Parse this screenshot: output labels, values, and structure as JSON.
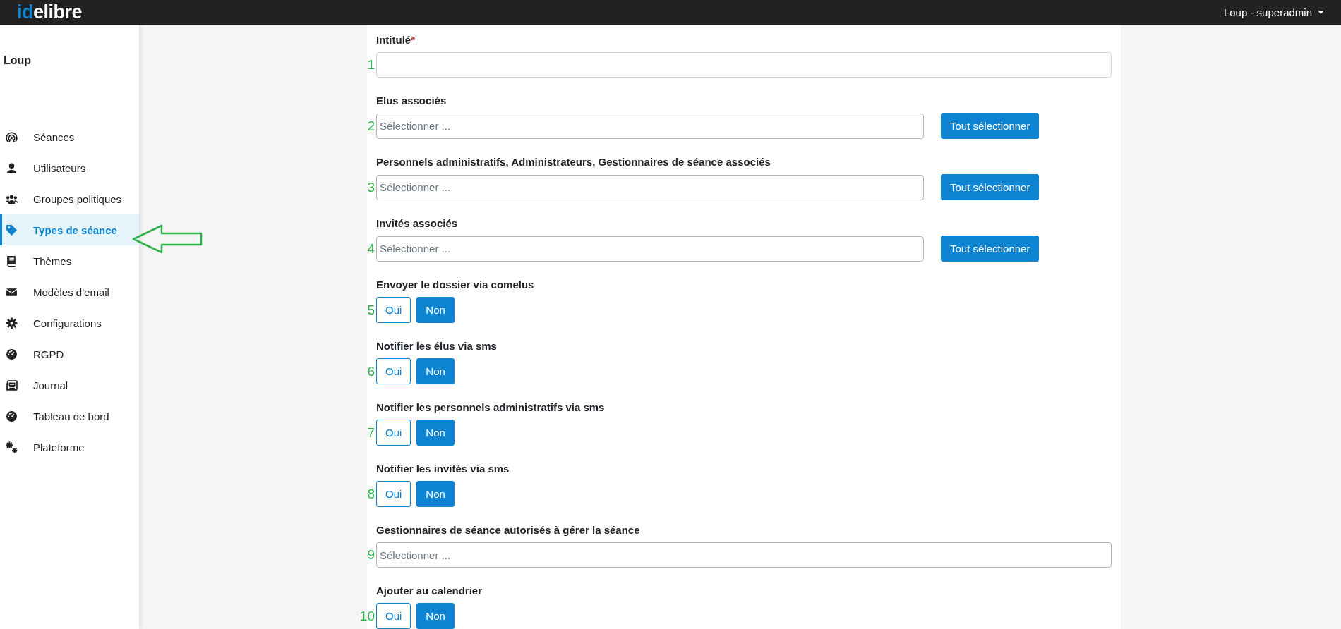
{
  "topbar": {
    "logo_accent": "id",
    "logo_rest": "elibre",
    "user_menu": "Loup - superadmin"
  },
  "sidebar": {
    "title": "Loup",
    "items": [
      {
        "label": "Séances",
        "selected": false
      },
      {
        "label": "Utilisateurs",
        "selected": false
      },
      {
        "label": "Groupes politiques",
        "selected": false
      },
      {
        "label": "Types de séance",
        "selected": true
      },
      {
        "label": "Thèmes",
        "selected": false
      },
      {
        "label": "Modèles d'email",
        "selected": false
      },
      {
        "label": "Configurations",
        "selected": false
      },
      {
        "label": "RGPD",
        "selected": false
      },
      {
        "label": "Journal",
        "selected": false
      },
      {
        "label": "Tableau de bord",
        "selected": false
      },
      {
        "label": "Plateforme",
        "selected": false
      }
    ]
  },
  "form": {
    "fields": [
      {
        "kind": "text",
        "marker": "1",
        "label": "Intitulé",
        "required_mark": "*"
      },
      {
        "kind": "select",
        "marker": "2",
        "label": "Elus associés",
        "placeholder": "Sélectionner ...",
        "button": "Tout sélectionner"
      },
      {
        "kind": "select",
        "marker": "3",
        "label": "Personnels administratifs, Administrateurs, Gestionnaires de séance associés",
        "placeholder": "Sélectionner ...",
        "button": "Tout sélectionner"
      },
      {
        "kind": "select",
        "marker": "4",
        "label": "Invités associés",
        "placeholder": "Sélectionner ...",
        "button": "Tout sélectionner"
      },
      {
        "kind": "toggle",
        "marker": "5",
        "label": "Envoyer le dossier via comelus",
        "options": [
          {
            "label": "Oui",
            "selected": false
          },
          {
            "label": "Non",
            "selected": true
          }
        ]
      },
      {
        "kind": "toggle",
        "marker": "6",
        "label": "Notifier les élus via sms",
        "options": [
          {
            "label": "Oui",
            "selected": false
          },
          {
            "label": "Non",
            "selected": true
          }
        ]
      },
      {
        "kind": "toggle",
        "marker": "7",
        "label": "Notifier les personnels administratifs via sms",
        "options": [
          {
            "label": "Oui",
            "selected": false
          },
          {
            "label": "Non",
            "selected": true
          }
        ]
      },
      {
        "kind": "toggle",
        "marker": "8",
        "label": "Notifier les invités via sms",
        "options": [
          {
            "label": "Oui",
            "selected": false
          },
          {
            "label": "Non",
            "selected": true
          }
        ]
      },
      {
        "kind": "wide-select",
        "marker": "9",
        "label": "Gestionnaires de séance autorisés à gérer la séance",
        "placeholder": "Sélectionner ..."
      },
      {
        "kind": "toggle",
        "marker": "10",
        "label": "Ajouter au calendrier",
        "options": [
          {
            "label": "Oui",
            "selected": false
          },
          {
            "label": "Non",
            "selected": true
          }
        ]
      }
    ]
  }
}
